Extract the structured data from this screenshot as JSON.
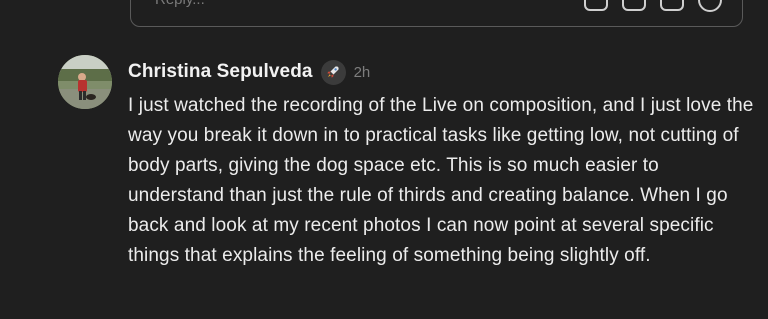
{
  "composer": {
    "placeholder": "Reply..."
  },
  "comment": {
    "author": "Christina Sepulveda",
    "badge_icon": "rocket-icon",
    "timestamp": "2h",
    "body": "I just watched the recording of the Live on composition, and I just love the way you break it down in to practical tasks like getting low, not cutting of body parts, giving the dog space etc. This is so much easier to understand than just the rule of thirds and creating balance. When I go back and look at my recent photos I can now point at several specific things that explains the feeling of something being slightly off."
  },
  "colors": {
    "background": "#1f1f1f",
    "text": "#ececec",
    "muted": "#7d7d7d",
    "border": "#5a5a5a"
  }
}
